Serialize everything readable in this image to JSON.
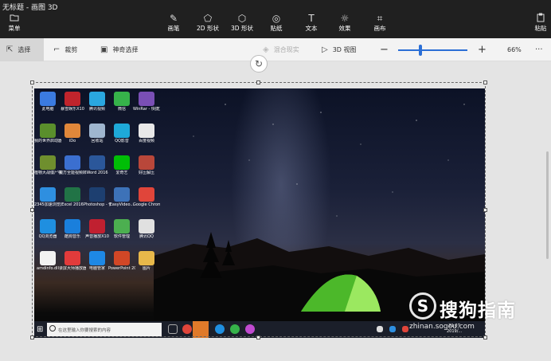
{
  "window": {
    "title": "无标题 - 画图 3D"
  },
  "toolbar": {
    "menu": "菜单",
    "tools": [
      {
        "label": "画笔",
        "icon": "brush-icon"
      },
      {
        "label": "2D 形状",
        "icon": "2d-shapes-icon"
      },
      {
        "label": "3D 形状",
        "icon": "3d-shapes-icon"
      },
      {
        "label": "贴纸",
        "icon": "stickers-icon"
      },
      {
        "label": "文本",
        "icon": "text-icon"
      },
      {
        "label": "效果",
        "icon": "effects-icon"
      },
      {
        "label": "画布",
        "icon": "canvas-icon"
      }
    ],
    "paste": "粘贴"
  },
  "subbar": {
    "select": "选择",
    "crop": "裁剪",
    "magic_select": "神奇选择",
    "mixed_reality": "混合现实",
    "view_3d": "3D 视图",
    "zoom_percent": "66%",
    "zoom_level": 66,
    "more": "···"
  },
  "desktop": {
    "icons": [
      {
        "label": "此电脑",
        "color": "#3b7be0"
      },
      {
        "label": "暴雪娱乐X10",
        "color": "#c0242c"
      },
      {
        "label": "腾讯视频",
        "color": "#2aa7e0"
      },
      {
        "label": "微信",
        "color": "#36b24a"
      },
      {
        "label": "WinRar - 快捷方式",
        "color": "#7a4fb5"
      },
      {
        "label": "我的世界启动器",
        "color": "#5a8f2c"
      },
      {
        "label": "iDo",
        "color": "#e0873a"
      },
      {
        "label": "回收站",
        "color": "#9fb6cf"
      },
      {
        "label": "QQ影音",
        "color": "#1ea9d8"
      },
      {
        "label": "百度视频",
        "color": "#e8e8e8"
      },
      {
        "label": "植物大战僵尸中文版",
        "color": "#6f8f2e"
      },
      {
        "label": "魔方全能视频转换器",
        "color": "#3b6fd0"
      },
      {
        "label": "Word 2016",
        "color": "#2b579a"
      },
      {
        "label": "爱奇艺",
        "color": "#00be06"
      },
      {
        "label": "好压解压",
        "color": "#b9473a"
      },
      {
        "label": "2345加速浏览器",
        "color": "#2e8fe0"
      },
      {
        "label": "Excel 2016",
        "color": "#217346"
      },
      {
        "label": "Photoshop - 快捷方式",
        "color": "#1d3f70"
      },
      {
        "label": "EasyVideo...",
        "color": "#3d72b8"
      },
      {
        "label": "Google Chrome",
        "color": "#e0453a"
      },
      {
        "label": "QQ浏览器",
        "color": "#1f8fe0"
      },
      {
        "label": "酷狗音乐",
        "color": "#1a7fdc"
      },
      {
        "label": "声音播放X10",
        "color": "#c02030"
      },
      {
        "label": "软件管理",
        "color": "#4caf50"
      },
      {
        "label": "腾讯QQ",
        "color": "#e0e0e0"
      },
      {
        "label": "amdinfo.dll",
        "color": "#f2f2f2"
      },
      {
        "label": "录屏大师播放器",
        "color": "#e23b3b"
      },
      {
        "label": "电脑管家",
        "color": "#1e88e5"
      },
      {
        "label": "PowerPoint 2016",
        "color": "#d24726"
      },
      {
        "label": "图片",
        "color": "#e8b84a"
      }
    ],
    "search_placeholder": "在这里输入你要搜索的内容",
    "clock_time": "21:07",
    "clock_date": "2019/..."
  },
  "watermark": {
    "text": "搜狗指南",
    "url": "zhinan.sogou.com",
    "logo": "S"
  }
}
